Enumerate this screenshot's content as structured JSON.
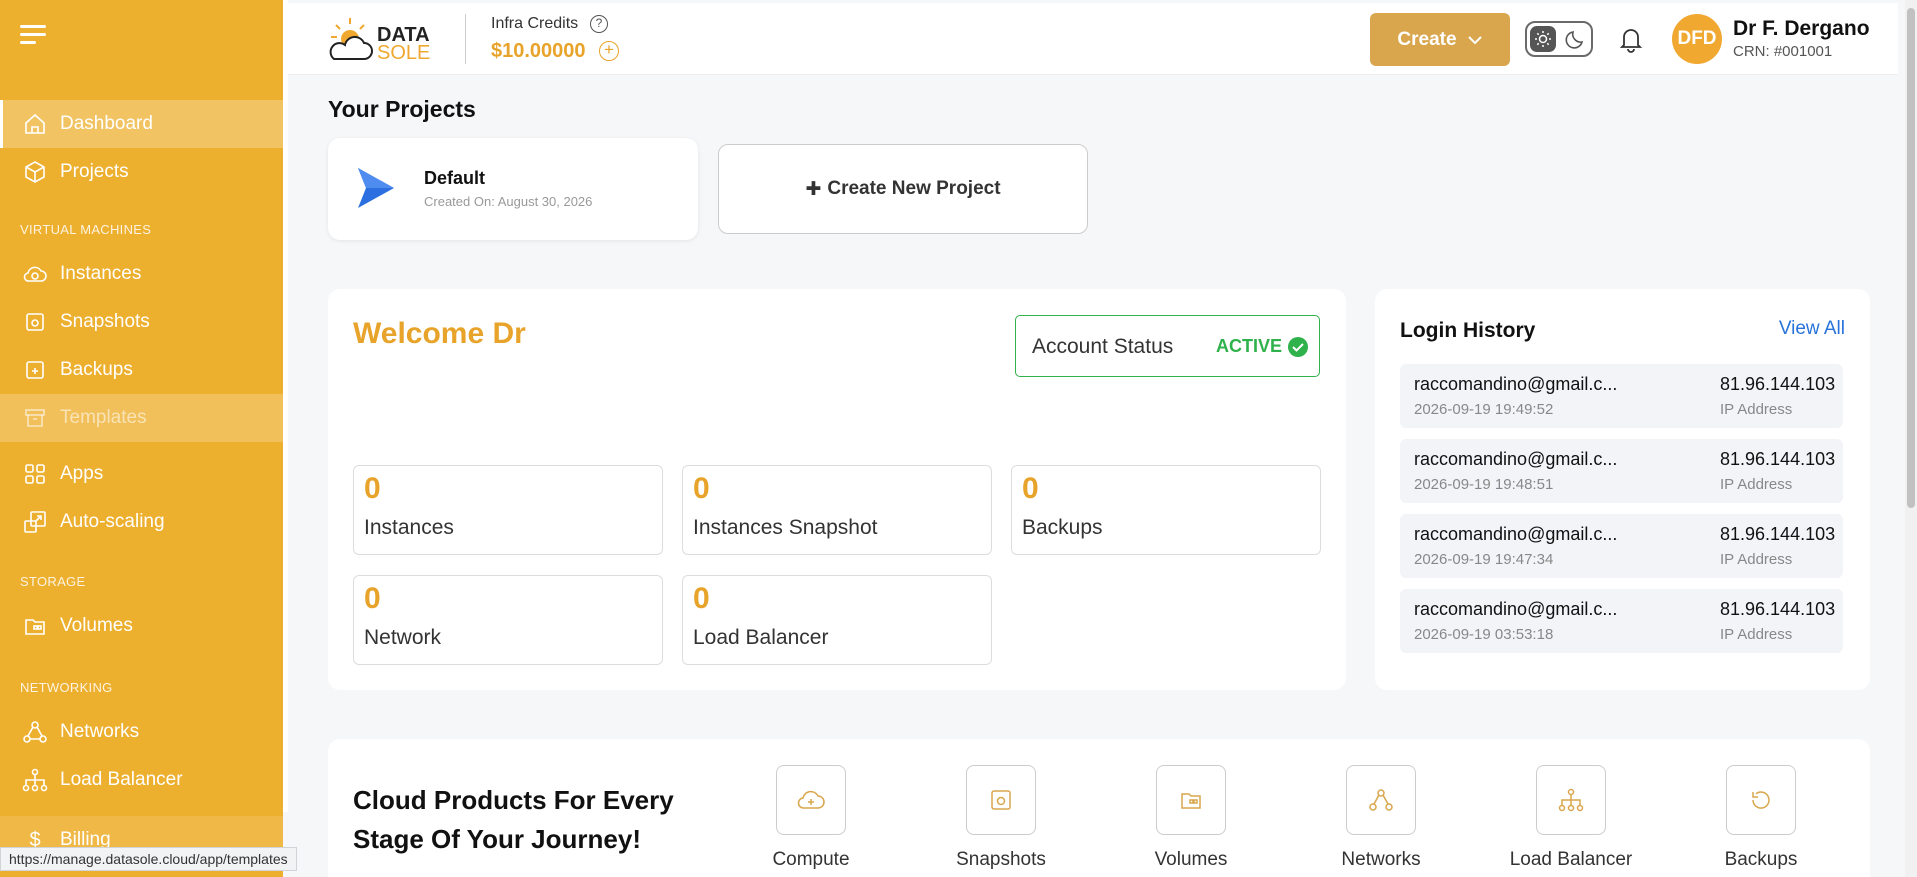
{
  "sidebar": {
    "items": [
      {
        "label": "Dashboard"
      },
      {
        "label": "Projects"
      },
      {
        "label": "Instances"
      },
      {
        "label": "Snapshots"
      },
      {
        "label": "Backups"
      },
      {
        "label": "Templates"
      },
      {
        "label": "Apps"
      },
      {
        "label": "Auto-scaling"
      },
      {
        "label": "Volumes"
      },
      {
        "label": "Networks"
      },
      {
        "label": "Load Balancer"
      },
      {
        "label": "Billing"
      }
    ],
    "sections": [
      "VIRTUAL MACHINES",
      "STORAGE",
      "NETWORKING"
    ]
  },
  "status_url": "https://manage.datasole.cloud/app/templates",
  "header": {
    "logo_top": "DATA",
    "logo_bottom": "SOLE",
    "credits_label": "Infra Credits",
    "credits_value": "$10.00000",
    "create_label": "Create",
    "avatar_initials": "DFD",
    "user_name": "Dr F. Dergano",
    "user_crn": "CRN: #001001"
  },
  "projects": {
    "title": "Your Projects",
    "default_name": "Default",
    "default_date": "Created On: August 30, 2026",
    "new_label": "Create New Project"
  },
  "welcome": {
    "title": "Welcome Dr",
    "status_label": "Account Status",
    "status_value": "ACTIVE",
    "stats": [
      {
        "value": "0",
        "label": "Instances"
      },
      {
        "value": "0",
        "label": "Instances Snapshot"
      },
      {
        "value": "0",
        "label": "Backups"
      },
      {
        "value": "0",
        "label": "Network"
      },
      {
        "value": "0",
        "label": "Load Balancer"
      }
    ]
  },
  "history": {
    "title": "Login History",
    "view_all": "View All",
    "rows": [
      {
        "email": "raccomandino@gmail.c...",
        "time": "2026-09-19 19:49:52",
        "ip": "81.96.144.103",
        "ip_label": "IP Address"
      },
      {
        "email": "raccomandino@gmail.c...",
        "time": "2026-09-19 19:48:51",
        "ip": "81.96.144.103",
        "ip_label": "IP Address"
      },
      {
        "email": "raccomandino@gmail.c...",
        "time": "2026-09-19 19:47:34",
        "ip": "81.96.144.103",
        "ip_label": "IP Address"
      },
      {
        "email": "raccomandino@gmail.c...",
        "time": "2026-09-19 03:53:18",
        "ip": "81.96.144.103",
        "ip_label": "IP Address"
      }
    ]
  },
  "products": {
    "title": "Cloud Products For Every Stage Of Your Journey!",
    "items": [
      {
        "label": "Compute",
        "icon": "cloud-plus-icon"
      },
      {
        "label": "Snapshots",
        "icon": "camera-icon"
      },
      {
        "label": "Volumes",
        "icon": "folder-icon"
      },
      {
        "label": "Networks",
        "icon": "network-icon"
      },
      {
        "label": "Load Balancer",
        "icon": "hierarchy-icon"
      },
      {
        "label": "Backups",
        "icon": "refresh-icon"
      }
    ]
  },
  "colors": {
    "accent": "#edaf2e",
    "active": "#2fb14b",
    "link": "#2773d9"
  }
}
